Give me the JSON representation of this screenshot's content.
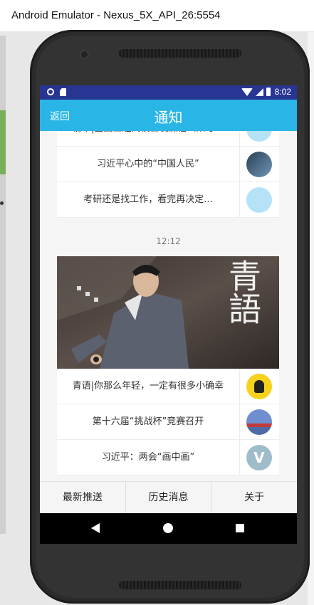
{
  "window": {
    "title": "Android Emulator - Nexus_5X_API_26:5554"
  },
  "status_bar": {
    "time": "8:02"
  },
  "app_bar": {
    "back_label": "返回",
    "title": "通知"
  },
  "content": {
    "top_card": [
      {
        "title": "榜单|全国首超高校首发微信公众号...",
        "thumb_color": "#b6e2f5"
      },
      {
        "title": "习近平心中的“中国人民”",
        "thumb_color": "#3a5a78"
      },
      {
        "title": "考研还是找工作，看完再决定...",
        "thumb_color": "#b6e2f5"
      }
    ],
    "group_time": "12:12",
    "cover_caption": "青語",
    "bottom_card": [
      {
        "title": "青语|你那么年轻，一定有很多小确幸",
        "thumb_color": "#f6d21c"
      },
      {
        "title": "第十六届“挑战杯”竞赛召开",
        "thumb_color": "#6f8fd0"
      },
      {
        "title": "习近平：两会“画中画”",
        "thumb_color": "#9fbccb",
        "thumb_glyph": "V"
      }
    ]
  },
  "bottom_nav": [
    "最新推送",
    "历史消息",
    "关于"
  ]
}
